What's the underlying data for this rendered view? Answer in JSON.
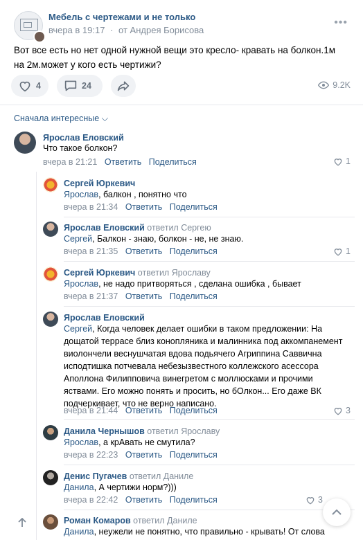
{
  "post": {
    "group_name": "Мебель с чертежами и не только",
    "time": "вчера в 19:17",
    "from": "от Андрея Борисова",
    "text": "Вот все есть но нет одной нужной вещи это кресло- кравать на болкон.1м на 2м.может у кого есть чертижи?",
    "likes": "4",
    "comments": "24",
    "views": "9.2K",
    "more_icon": "•••"
  },
  "comments_header": {
    "sort_label": "Сначала интересные ⌵"
  },
  "comments": [
    {
      "author": "Ярослав Еловский",
      "replied": "",
      "addr": "",
      "text": "Что такое болкон?",
      "time": "вчера в 21:21",
      "likes": "1"
    },
    {
      "author": "Сергей Юркевич",
      "replied": "",
      "addr": "Ярослав",
      "text": ", балкон , понятно что",
      "time": "вчера в 21:34",
      "likes": ""
    },
    {
      "author": "Ярослав Еловский",
      "replied": "ответил Сергею",
      "addr": "Сергей",
      "text": ", Балкон - знаю, болкон - не, не знаю.",
      "time": "вчера в 21:35",
      "likes": "1"
    },
    {
      "author": "Сергей Юркевич",
      "replied": "ответил Ярославу",
      "addr": "Ярослав",
      "text": ", не надо притворяться , сделана ошибка , бывает",
      "time": "вчера в 21:37",
      "likes": ""
    },
    {
      "author": "Ярослав Еловский",
      "replied": "",
      "addr": "Сергей",
      "text": ", Когда человек делает ошибки в таком предложении: На дощатой террасе близ конопляника и малинника под аккомпанемент виолончели веснушчатая вдова подьячего Агриппина Саввична исподтишка потчевала небезызвестного коллежского асессора Аполлона Филипповича винегретом с моллюсками и прочими яствами. Его можно понять и просить, но бОлкон... Его даже ВК подчеркивает, что не верно написано.",
      "time": "вчера в 21:44",
      "likes": "3"
    },
    {
      "author": "Данила Чернышов",
      "replied": "ответил Ярославу",
      "addr": "Ярослав",
      "text": ", а крАвать не смутила?",
      "time": "вчера в 22:23",
      "likes": ""
    },
    {
      "author": "Денис Пугачев",
      "replied": "ответил Даниле",
      "addr": "Данила",
      "text": ", А чертижи норм?)))",
      "time": "вчера в 22:42",
      "likes": "3"
    },
    {
      "author": "Роман Комаров",
      "replied": "ответил Даниле",
      "addr": "Данила",
      "text": ", неужели не понятно, что правильно - крывать! От слова",
      "time": "",
      "likes": ""
    }
  ],
  "labels": {
    "reply": "Ответить",
    "share": "Поделиться"
  },
  "colors": {
    "link": "#2a5885",
    "muted": "#818c99",
    "divider": "#e7e8ec"
  }
}
